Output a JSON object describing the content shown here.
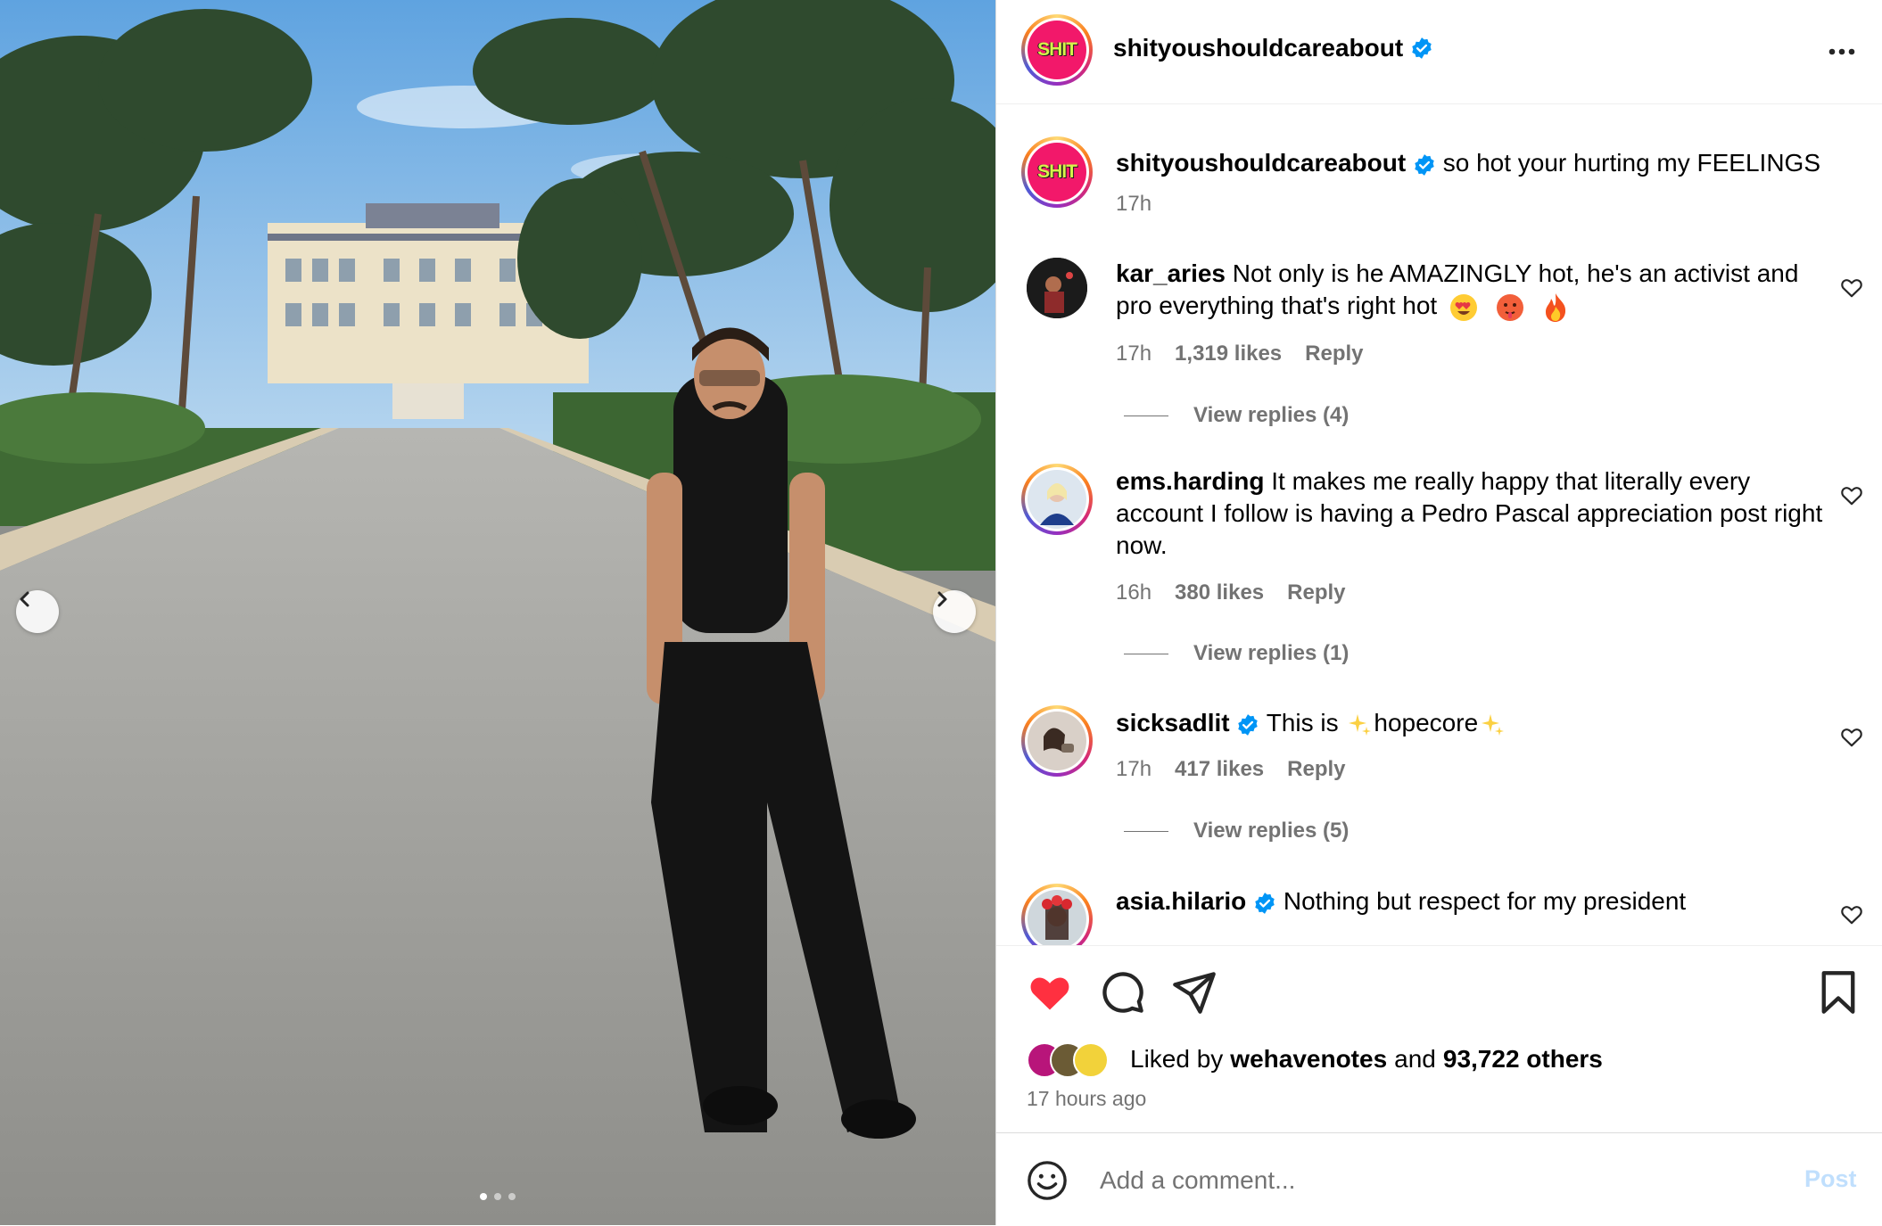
{
  "post": {
    "author": "shityoushouldcareabout",
    "author_logo_text": "SHIT",
    "caption": "so hot your hurting my FEELINGS",
    "caption_time": "17h",
    "carousel": {
      "dot_count": 3,
      "active_dot": 0
    }
  },
  "comments": [
    {
      "username": "kar_aries",
      "verified": false,
      "text": "Not only is he AMAZINGLY hot, he's an activist and pro everything that's right hot",
      "emojis": [
        "heart-eyes-emoji",
        "hot-face-emoji",
        "fire-emoji"
      ],
      "time": "17h",
      "likes": "1,319 likes",
      "reply": "Reply",
      "view_replies": "View replies (4)"
    },
    {
      "username": "ems.harding",
      "verified": false,
      "text": "It makes me really happy that literally every account I follow is having a Pedro Pascal appreciation post right now.",
      "time": "16h",
      "likes": "380 likes",
      "reply": "Reply",
      "view_replies": "View replies (1)"
    },
    {
      "username": "sicksadlit",
      "verified": true,
      "text_before": "This is",
      "text_mid": "hopecore",
      "time": "17h",
      "likes": "417 likes",
      "reply": "Reply",
      "view_replies": "View replies (5)"
    },
    {
      "username": "asia.hilario",
      "verified": true,
      "text": "Nothing but respect for my president"
    }
  ],
  "likes": {
    "prefix": "Liked by",
    "user": "wehavenotes",
    "and": "and",
    "others": "93,722 others"
  },
  "posted_ago": "17 hours ago",
  "add_comment": {
    "placeholder": "Add a comment...",
    "post_label": "Post"
  },
  "colors": {
    "like_red": "#ff3040",
    "verified_blue": "#0095f6",
    "secondary_text": "#737373",
    "post_disabled": "#c0dffd"
  },
  "icons": {
    "header_more": "more-horizontal-icon",
    "like": "heart-filled-icon",
    "comment": "comment-bubble-icon",
    "share": "paper-plane-icon",
    "save": "bookmark-icon",
    "emoji_picker": "smiley-icon",
    "carousel_prev": "chevron-left-icon",
    "carousel_next": "chevron-right-icon"
  }
}
